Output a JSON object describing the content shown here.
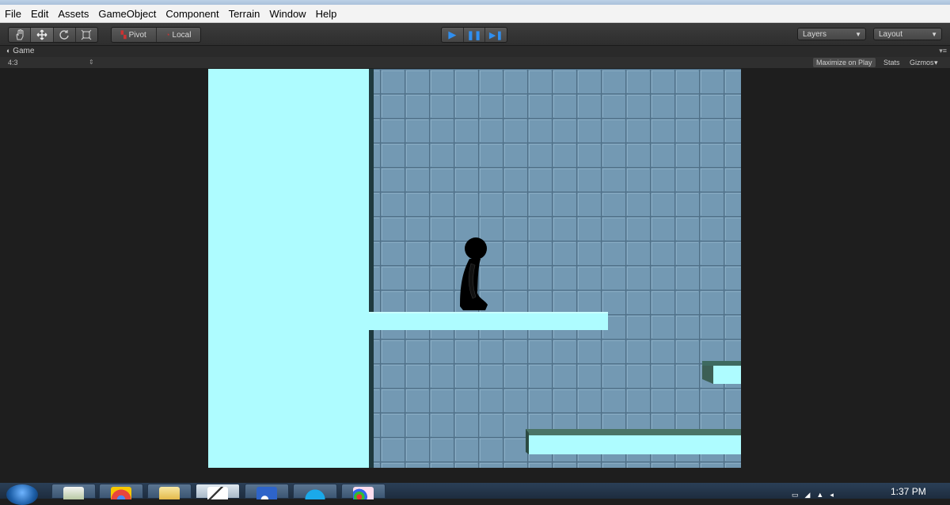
{
  "menu": {
    "items": [
      "File",
      "Edit",
      "Assets",
      "GameObject",
      "Component",
      "Terrain",
      "Window",
      "Help"
    ]
  },
  "toolbar": {
    "pivot_label": "Pivot",
    "local_label": "Local",
    "layers_label": "Layers",
    "layout_label": "Layout"
  },
  "game_tab": {
    "title": "Game",
    "aspect": "4:3",
    "maximize_label": "Maximize on Play",
    "stats_label": "Stats",
    "gizmos_label": "Gizmos"
  },
  "icons": {
    "tools": [
      "hand-icon",
      "move-icon",
      "rotate-icon",
      "scale-icon"
    ],
    "playback": [
      "play-icon",
      "pause-icon",
      "step-icon"
    ]
  },
  "colors": {
    "wall": "#aefcff",
    "tile": "#7399b3",
    "tile_line": "#4f6f86",
    "play_accent": "#2f8ff0"
  },
  "taskbar": {
    "clock": "1:37 PM"
  }
}
